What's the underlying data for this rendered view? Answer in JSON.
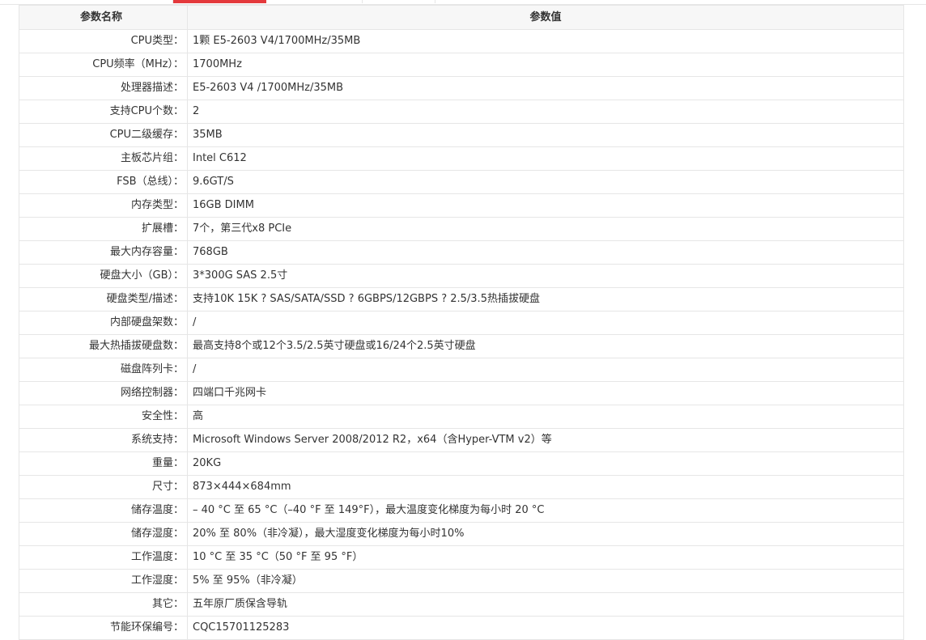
{
  "table": {
    "header_name": "参数名称",
    "header_value": "参数值",
    "rows": [
      {
        "name": "CPU类型：",
        "value": "1颗 E5-2603 V4/1700MHz/35MB"
      },
      {
        "name": "CPU频率（MHz）：",
        "value": "1700MHz"
      },
      {
        "name": "处理器描述：",
        "value": "E5-2603 V4 /1700MHz/35MB"
      },
      {
        "name": "支持CPU个数：",
        "value": "2"
      },
      {
        "name": "CPU二级缓存：",
        "value": "35MB"
      },
      {
        "name": "主板芯片组：",
        "value": "Intel C612"
      },
      {
        "name": "FSB（总线）：",
        "value": "9.6GT/S"
      },
      {
        "name": "内存类型：",
        "value": "16GB DIMM"
      },
      {
        "name": "扩展槽：",
        "value": "7个，第三代x8 PCIe"
      },
      {
        "name": "最大内存容量：",
        "value": "768GB"
      },
      {
        "name": "硬盘大小（GB）：",
        "value": "3*300G SAS 2.5寸"
      },
      {
        "name": "硬盘类型/描述：",
        "value": "支持10K 15K ? SAS/SATA/SSD ? 6GBPS/12GBPS ? 2.5/3.5热插拔硬盘"
      },
      {
        "name": "内部硬盘架数：",
        "value": "/"
      },
      {
        "name": "最大热插拔硬盘数：",
        "value": "最高支持8个或12个3.5/2.5英寸硬盘或16/24个2.5英寸硬盘"
      },
      {
        "name": "磁盘阵列卡：",
        "value": "/"
      },
      {
        "name": "网络控制器：",
        "value": "四端口千兆网卡"
      },
      {
        "name": "安全性：",
        "value": "高"
      },
      {
        "name": "系统支持：",
        "value": "Microsoft Windows Server 2008/2012 R2，x64（含Hyper-VTM v2）等"
      },
      {
        "name": "重量：",
        "value": "20KG"
      },
      {
        "name": "尺寸：",
        "value": "873×444×684mm"
      },
      {
        "name": "储存温度：",
        "value": "– 40 °C 至 65 °C（–40 °F 至 149°F），最大温度变化梯度为每小时 20 °C"
      },
      {
        "name": "储存湿度：",
        "value": "20% 至 80%（非冷凝），最大湿度变化梯度为每小时10%"
      },
      {
        "name": "工作温度：",
        "value": "10 °C 至 35 °C（50 °F 至 95 °F）"
      },
      {
        "name": "工作湿度：",
        "value": "5% 至 95%（非冷凝）"
      },
      {
        "name": "其它：",
        "value": "五年原厂质保含导轨"
      },
      {
        "name": "节能环保编号：",
        "value": "CQC15701125283"
      }
    ]
  },
  "colors": {
    "active_tab": "#e4393c",
    "border": "#e6e6e6",
    "header_bg": "#f7f7f7",
    "text": "#333333"
  }
}
